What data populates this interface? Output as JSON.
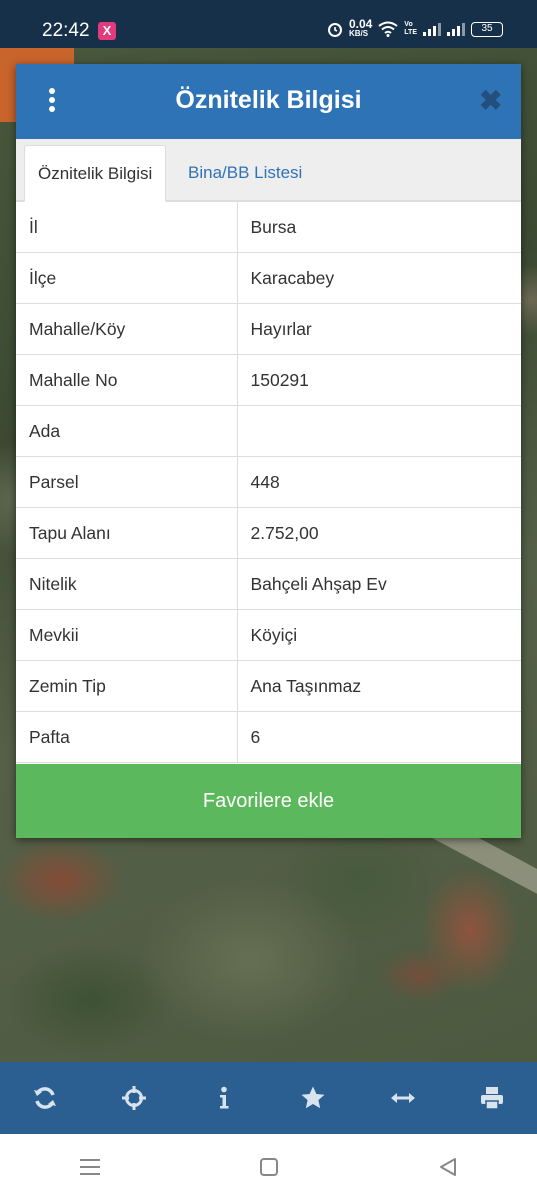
{
  "status_bar": {
    "time": "22:42",
    "app_badge": "X",
    "net_speed_value": "0.04",
    "net_speed_unit": "KB/S",
    "volte_top": "Vo",
    "volte_bottom": "LTE",
    "battery": "35"
  },
  "dialog": {
    "title": "Öznitelik Bilgisi",
    "menu_icon": "kebab-menu-icon",
    "close_icon": "close-icon",
    "tabs": [
      {
        "label": "Öznitelik Bilgisi",
        "active": true
      },
      {
        "label": "Bina/BB Listesi",
        "active": false
      }
    ],
    "rows": [
      {
        "key": "İl",
        "value": "Bursa"
      },
      {
        "key": "İlçe",
        "value": "Karacabey"
      },
      {
        "key": "Mahalle/Köy",
        "value": "Hayırlar"
      },
      {
        "key": "Mahalle No",
        "value": "150291"
      },
      {
        "key": "Ada",
        "value": ""
      },
      {
        "key": "Parsel",
        "value": "448"
      },
      {
        "key": "Tapu Alanı",
        "value": "2.752,00"
      },
      {
        "key": "Nitelik",
        "value": "Bahçeli Ahşap Ev"
      },
      {
        "key": "Mevkii",
        "value": "Köyiçi"
      },
      {
        "key": "Zemin Tip",
        "value": "Ana Taşınmaz"
      },
      {
        "key": "Pafta",
        "value": "6"
      }
    ],
    "favorite_button": "Favorilere ekle"
  },
  "toolbar": {
    "icons": [
      "refresh-icon",
      "locate-icon",
      "info-icon",
      "star-icon",
      "measure-icon",
      "print-icon"
    ]
  },
  "navbar": {
    "icons": [
      "menu-icon",
      "home-icon",
      "back-icon"
    ]
  },
  "colors": {
    "header_blue": "#2f73b7",
    "toolbar_blue": "#2b5f91",
    "favorite_green": "#5cb85c",
    "status_bar": "#17304a"
  }
}
